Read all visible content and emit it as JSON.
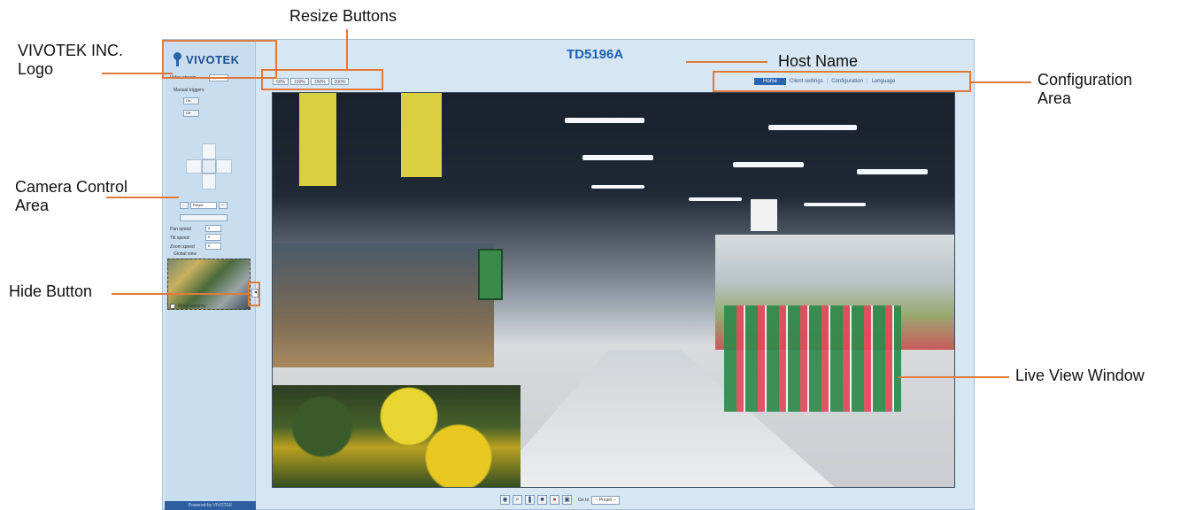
{
  "annotations": {
    "logo": "VIVOTEK INC.\n Logo",
    "resize_buttons": "Resize Buttons",
    "host_name": "Host Name",
    "configuration_area": "Configuration\nArea",
    "camera_control_area": "Camera Control\nArea",
    "hide_button": "Hide Button",
    "live_view_window": "Live View Window"
  },
  "app": {
    "logo_text": "VIVOTEK",
    "host_name": "TD5196A",
    "resize_buttons": [
      "50%",
      "100%",
      "150%",
      "200%"
    ],
    "config_nav": [
      "Home",
      "Client settings",
      "Configuration",
      "Language"
    ],
    "sidebar": {
      "video_stream_label": "Video stream",
      "manual_triggers_label": "Manual triggers",
      "trigger_on": "On",
      "trigger_off": "Off",
      "preset_value": "Preset",
      "pan_speed_label": "Pan speed",
      "tilt_speed_label": "Tilt speed",
      "zoom_speed_label": "Zoom speed",
      "pan_speed_value": "0",
      "tilt_speed_value": "0",
      "zoom_speed_value": "0",
      "global_view_label": "Global view",
      "move_instantly_label": "Move instantly",
      "powered_by": "Powered by VIVOTEK"
    },
    "bottom_bar": {
      "go_to_label": "Go to",
      "go_to_value": "-- Preset --"
    }
  },
  "colors": {
    "accent": "#e07a3a",
    "host_name": "#2060b0",
    "panel": "#d7e6f3"
  }
}
